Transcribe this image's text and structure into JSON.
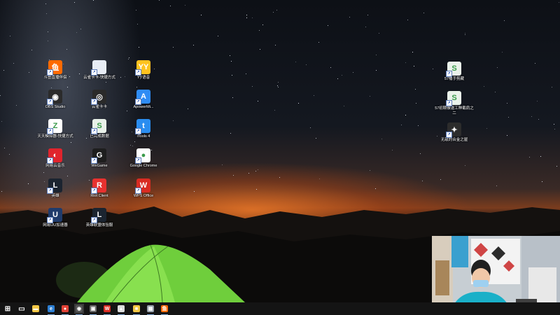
{
  "desktop": {
    "icons_left": [
      {
        "label": "斗鱼直播伴侣",
        "name": "douyu-icon",
        "color": "#ff6a00",
        "glyph": "鱼"
      },
      {
        "label": "云雀卡卡-快捷方式",
        "name": "shortcut-file-icon",
        "color": "#e8edf5",
        "glyph": ""
      },
      {
        "label": "YY语音",
        "name": "yy-icon",
        "color": "#ffc21f",
        "glyph": "YY"
      },
      {
        "label": "OBS Studio",
        "name": "obs-icon",
        "color": "#2b2b2b",
        "glyph": "◉"
      },
      {
        "label": "云雀卡卡",
        "name": "yunque-icon",
        "color": "#2a2a2a",
        "glyph": "◎"
      },
      {
        "label": "ApowerMi...",
        "name": "apowermirror-icon",
        "color": "#2f8cf5",
        "glyph": "A"
      },
      {
        "label": "天天模拟器-快捷方式",
        "name": "emulator-icon",
        "color": "#ffffff",
        "glyph": "Z"
      },
      {
        "label": "已完成数据",
        "name": "excel-file-icon",
        "color": "#e9f1e9",
        "glyph": "S"
      },
      {
        "label": "iTools 4",
        "name": "itools-icon",
        "color": "#2a8df0",
        "glyph": "t"
      },
      {
        "label": "网易云音乐",
        "name": "netease-music-icon",
        "color": "#e0242d",
        "glyph": "◐"
      },
      {
        "label": "WeGame",
        "name": "wegame-icon",
        "color": "#1e1e1e",
        "glyph": "G"
      },
      {
        "label": "Google Chrome",
        "name": "chrome-icon",
        "color": "#ffffff",
        "glyph": "●"
      },
      {
        "label": "英雄",
        "name": "lol-icon",
        "color": "#1b2430",
        "glyph": "L"
      },
      {
        "label": "Riot Client",
        "name": "riot-client-icon",
        "color": "#e8312f",
        "glyph": "R"
      },
      {
        "label": "WPS Office",
        "name": "wps-icon",
        "color": "#d92b22",
        "glyph": "W"
      },
      {
        "label": "网易UU加速器",
        "name": "uu-accelerator-icon",
        "color": "#1f3b6b",
        "glyph": "U"
      },
      {
        "label": "英雄联盟体验服",
        "name": "lol-pbe-icon",
        "color": "#1b2430",
        "glyph": "L"
      }
    ],
    "icons_right": [
      {
        "label": "57桶手剪藏",
        "name": "excel-doc-icon",
        "color": "#eaf2ea",
        "glyph": "S"
      },
      {
        "label": "57初期做退工种截肩之二",
        "name": "excel-doc-2-icon",
        "color": "#eaf2ea",
        "glyph": "S"
      },
      {
        "label": "无敌的合金之屋",
        "name": "game-shortcut-icon",
        "color": "#2c2c2c",
        "glyph": "✦"
      }
    ]
  },
  "taskbar": {
    "items": [
      {
        "name": "start-windows-icon",
        "glyph": "⊞",
        "color": "#ffffff"
      },
      {
        "name": "task-view-icon",
        "glyph": "▭",
        "color": "#ffffff"
      },
      {
        "name": "file-explorer-icon",
        "glyph": "▬",
        "color": "#f2c744"
      },
      {
        "name": "edge-browser-icon",
        "glyph": "e",
        "color": "#2d7fd3"
      },
      {
        "name": "chrome-taskbar-icon",
        "glyph": "●",
        "color": "#e04236"
      },
      {
        "name": "obs-taskbar-icon",
        "glyph": "◉",
        "color": "#555555"
      },
      {
        "name": "app-taskbar-icon",
        "glyph": "▣",
        "color": "#6a6a6a"
      },
      {
        "name": "wps-taskbar-icon",
        "glyph": "W",
        "color": "#d92b22"
      },
      {
        "name": "photos-taskbar-icon",
        "glyph": "▲",
        "color": "#dcdcdc"
      },
      {
        "name": "sticky-taskbar-icon",
        "glyph": "■",
        "color": "#f2c744"
      },
      {
        "name": "tool-taskbar-icon",
        "glyph": "▦",
        "color": "#9aa3ad"
      },
      {
        "name": "douyu-taskbar-icon",
        "glyph": "鱼",
        "color": "#ff6a00"
      }
    ]
  }
}
